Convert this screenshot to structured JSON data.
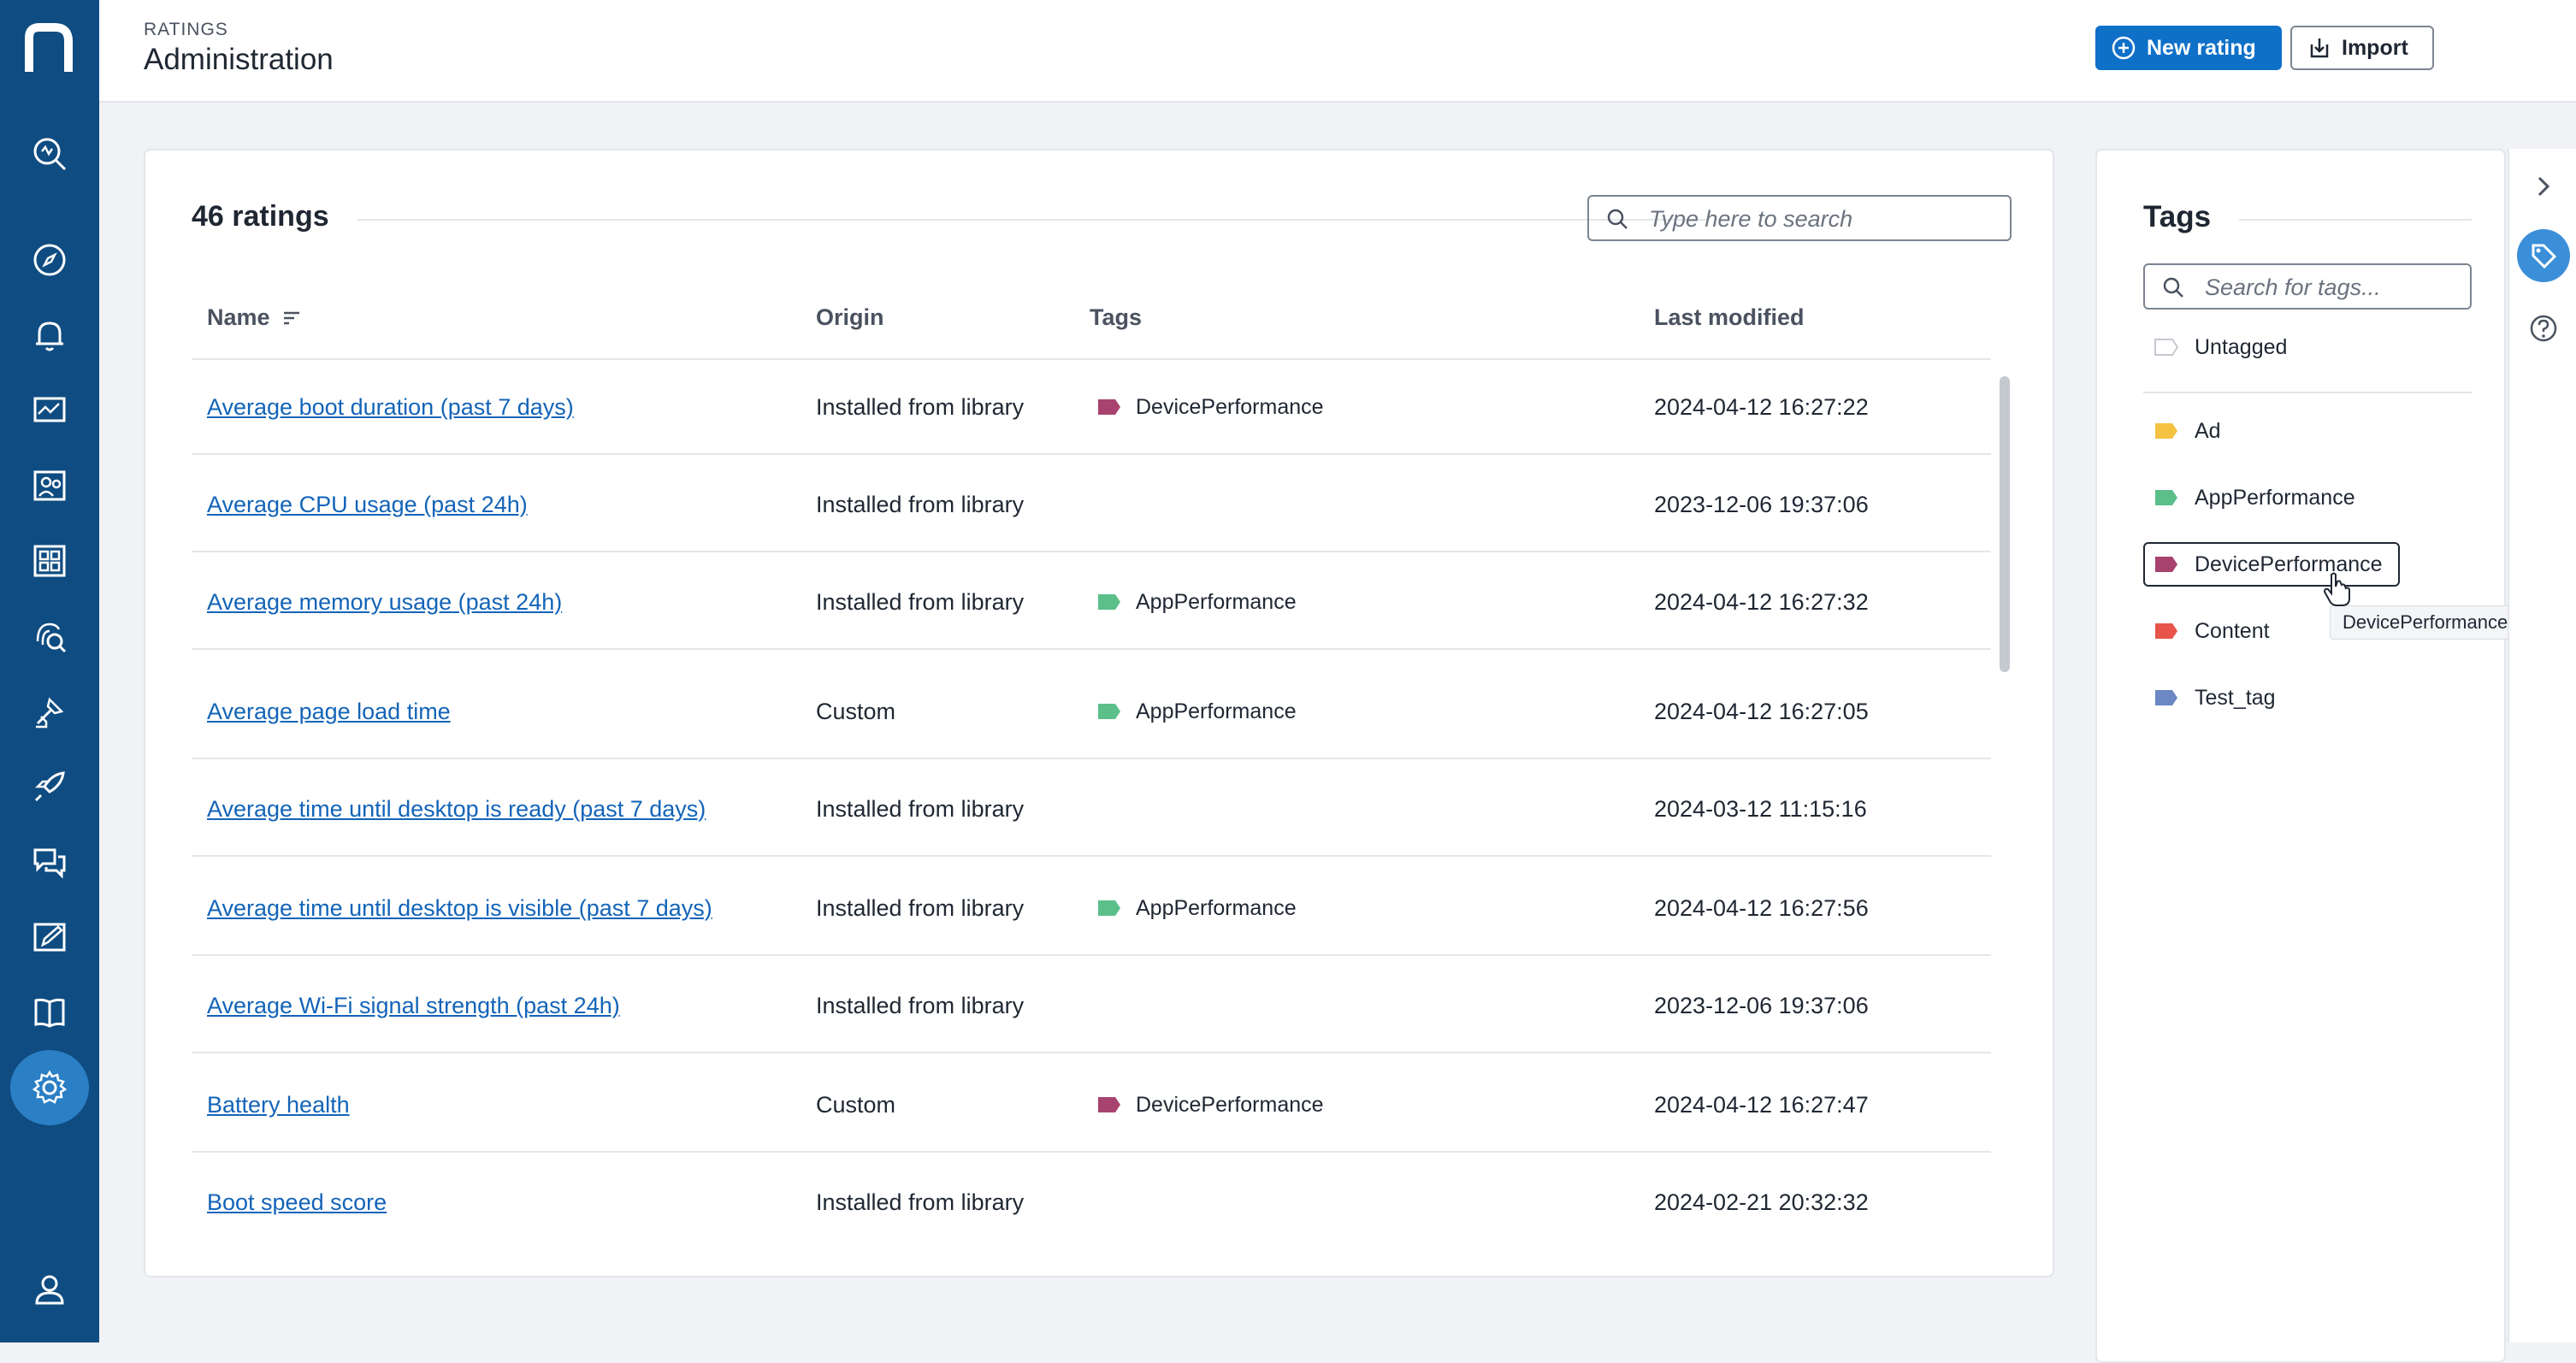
{
  "header": {
    "breadcrumb": "RATINGS",
    "title": "Administration",
    "new_button_label": "New rating",
    "import_button_label": "Import"
  },
  "sidebar": {
    "items": [
      {
        "name": "search-analytics-icon"
      },
      {
        "name": "compass-icon"
      },
      {
        "name": "bell-icon"
      },
      {
        "name": "monitor-chart-icon"
      },
      {
        "name": "people-icon"
      },
      {
        "name": "grid-apps-icon"
      },
      {
        "name": "fingerprint-search-icon"
      },
      {
        "name": "tools-icon"
      },
      {
        "name": "rocket-icon"
      },
      {
        "name": "chat-icon"
      },
      {
        "name": "edit-icon"
      },
      {
        "name": "book-icon"
      },
      {
        "name": "gear-icon",
        "active": true
      },
      {
        "name": "user-icon"
      }
    ]
  },
  "ratings": {
    "title": "46 ratings",
    "search_placeholder": "Type here to search",
    "columns": [
      "Name",
      "Origin",
      "Tags",
      "Last modified"
    ],
    "rows": [
      {
        "name": "Average boot duration (past 7 days)",
        "origin": "Installed from library",
        "tag": "DevicePerformance",
        "modified": "2024-04-12 16:27:22"
      },
      {
        "name": "Average CPU usage (past 24h)",
        "origin": "Installed from library",
        "tag": "",
        "modified": "2023-12-06 19:37:06"
      },
      {
        "name": "Average memory usage (past 24h)",
        "origin": "Installed from library",
        "tag": "AppPerformance",
        "modified": "2024-04-12 16:27:32"
      },
      {
        "name": "Average page load time",
        "origin": "Custom",
        "tag": "AppPerformance",
        "modified": "2024-04-12 16:27:05"
      },
      {
        "name": "Average time until desktop is ready (past 7 days)",
        "origin": "Installed from library",
        "tag": "",
        "modified": "2024-03-12 11:15:16"
      },
      {
        "name": "Average time until desktop is visible (past 7 days)",
        "origin": "Installed from library",
        "tag": "AppPerformance",
        "modified": "2024-04-12 16:27:56"
      },
      {
        "name": "Average Wi-Fi signal strength (past 24h)",
        "origin": "Installed from library",
        "tag": "",
        "modified": "2023-12-06 19:37:06"
      },
      {
        "name": "Battery health",
        "origin": "Custom",
        "tag": "DevicePerformance",
        "modified": "2024-04-12 16:27:47"
      },
      {
        "name": "Boot speed score",
        "origin": "Installed from library",
        "tag": "",
        "modified": "2024-02-21 20:32:32"
      }
    ]
  },
  "tags": {
    "title": "Tags",
    "search_placeholder": "Search for tags...",
    "untagged_label": "Untagged",
    "items": [
      {
        "label": "Ad",
        "color": "#f5c242"
      },
      {
        "label": "AppPerformance",
        "color": "#5cbf8a"
      },
      {
        "label": "DevicePerformance",
        "color": "#a8436f"
      },
      {
        "label": "Content",
        "color": "#e8534a"
      },
      {
        "label": "Test_tag",
        "color": "#6b87c4"
      }
    ],
    "tooltip": "DevicePerformance"
  },
  "colors": {
    "sidebar": "#0f4c81",
    "primary": "#0f70c8",
    "link": "#1364b8"
  }
}
